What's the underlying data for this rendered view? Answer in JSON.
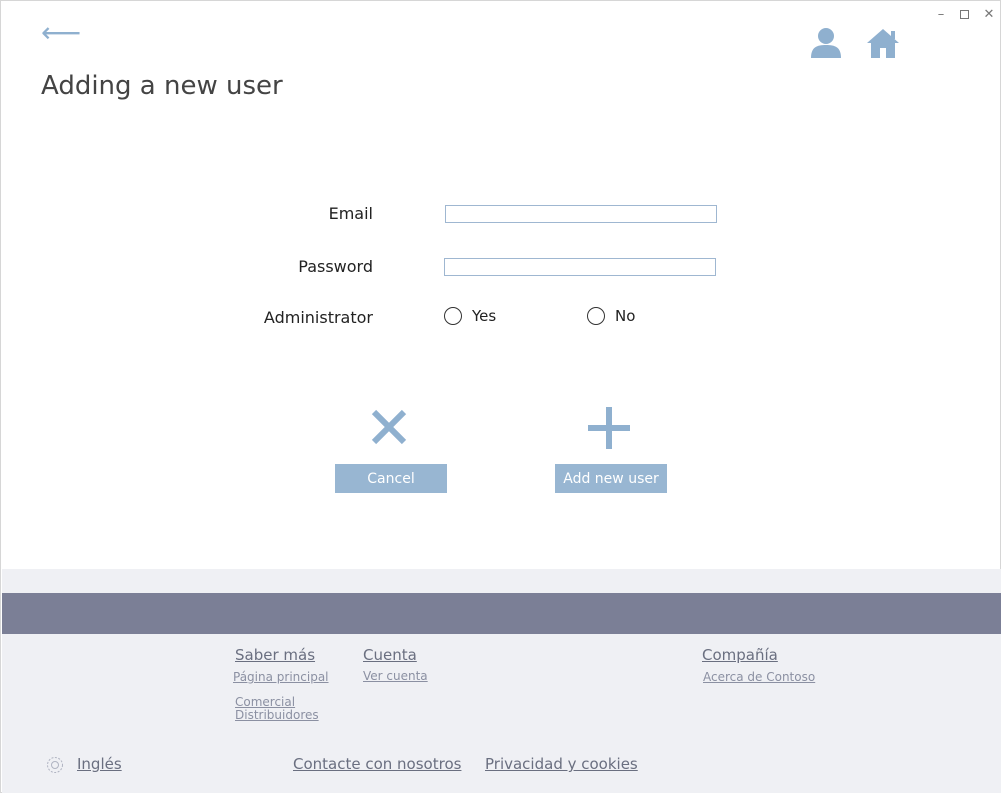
{
  "window": {
    "minimize_glyph": "–",
    "close_glyph": "✕"
  },
  "header": {
    "back_glyph": "⟵",
    "title": "Adding a new user",
    "icons": [
      "user-icon",
      "home-icon"
    ]
  },
  "form": {
    "email_label": "Email",
    "email_value": "",
    "email_placeholder": "",
    "password_label": "Password",
    "password_value": "",
    "password_placeholder": "",
    "admin_label": "Administrator",
    "admin_options": {
      "yes": "Yes",
      "no": "No"
    }
  },
  "actions": {
    "cancel_label": "Cancel",
    "add_label": "Add new user"
  },
  "footer": {
    "col1_title": "Saber más",
    "col1_links": [
      "Página principal",
      "Comercial",
      "Distribuidores"
    ],
    "col2_title": "Cuenta",
    "col2_links": [
      "Ver cuenta"
    ],
    "col3_title": "Compañía",
    "col3_links": [
      "Acerca de Contoso"
    ],
    "language": "Inglés",
    "contact": "Contacte con nosotros",
    "privacy": "Privacidad y cookies"
  },
  "colors": {
    "accent": "#98b6d2",
    "footer_band": "#7b7f96",
    "footer_bg": "#eff0f4"
  }
}
